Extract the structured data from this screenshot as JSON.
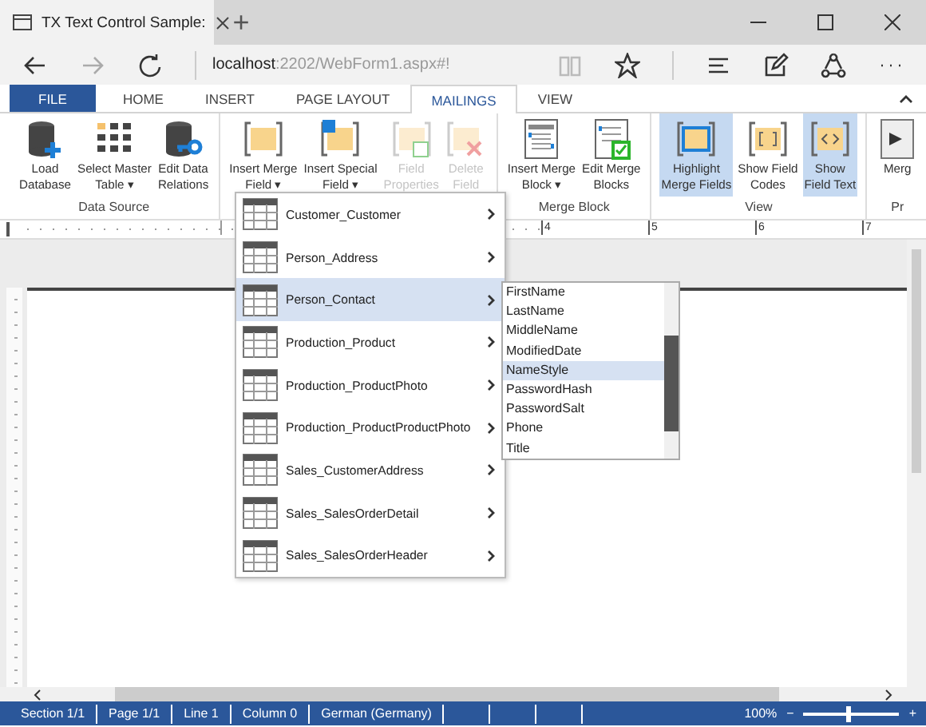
{
  "browser": {
    "tab_title": "TX Text Control Sample:",
    "new_tab": "+",
    "url_host": "localhost",
    "url_path": ":2202/WebForm1.aspx#!"
  },
  "ribbon": {
    "tabs": [
      {
        "label": "FILE",
        "kind": "file",
        "selected": false
      },
      {
        "label": "HOME",
        "kind": "tab",
        "selected": false
      },
      {
        "label": "INSERT",
        "kind": "tab",
        "selected": false
      },
      {
        "label": "PAGE LAYOUT",
        "kind": "tab",
        "selected": false
      },
      {
        "label": "MAILINGS",
        "kind": "tab",
        "selected": true
      },
      {
        "label": "VIEW",
        "kind": "tab",
        "selected": false
      }
    ],
    "groups": [
      {
        "label": "Data Source",
        "buttons": [
          {
            "label": "Load\nDatabase",
            "disabled": false,
            "selected": false
          },
          {
            "label": "Select Master\nTable ▾",
            "disabled": false,
            "selected": false
          },
          {
            "label": "Edit Data\nRelations",
            "disabled": false,
            "selected": false
          }
        ]
      },
      {
        "buttons": [
          {
            "label": "Insert Merge\nField ▾",
            "disabled": false,
            "selected": false
          },
          {
            "label": "Insert Special\nField ▾",
            "disabled": false,
            "selected": false
          },
          {
            "label": "Field\nProperties",
            "disabled": true,
            "selected": false
          },
          {
            "label": "Delete\nField",
            "disabled": true,
            "selected": false
          }
        ]
      },
      {
        "label": "Merge Block",
        "buttons": [
          {
            "label": "Insert Merge\nBlock ▾",
            "disabled": false,
            "selected": false
          },
          {
            "label": "Edit Merge\nBlocks",
            "disabled": false,
            "selected": false
          }
        ]
      },
      {
        "label": "View",
        "buttons": [
          {
            "label": "Highlight\nMerge Fields",
            "disabled": false,
            "selected": true
          },
          {
            "label": "Show Field\nCodes",
            "disabled": false,
            "selected": false
          },
          {
            "label": "Show\nField Text",
            "disabled": false,
            "selected": true
          }
        ]
      },
      {
        "label": "Pr",
        "buttons": [
          {
            "label": "Merg",
            "disabled": false,
            "selected": false
          }
        ]
      }
    ]
  },
  "ruler": {
    "numbers": [
      "4",
      "5",
      "6",
      "7"
    ]
  },
  "table_menu": {
    "items": [
      {
        "label": "Customer_Customer",
        "selected": false
      },
      {
        "label": "Person_Address",
        "selected": false
      },
      {
        "label": "Person_Contact",
        "selected": true
      },
      {
        "label": "Production_Product",
        "selected": false
      },
      {
        "label": "Production_ProductPhoto",
        "selected": false
      },
      {
        "label": "Production_ProductProductPhoto",
        "selected": false
      },
      {
        "label": "Sales_CustomerAddress",
        "selected": false
      },
      {
        "label": "Sales_SalesOrderDetail",
        "selected": false
      },
      {
        "label": "Sales_SalesOrderHeader",
        "selected": false
      }
    ]
  },
  "field_menu": {
    "items": [
      {
        "label": "FirstName",
        "selected": false
      },
      {
        "label": "LastName",
        "selected": false
      },
      {
        "label": "MiddleName",
        "selected": false
      },
      {
        "label": "ModifiedDate",
        "selected": false
      },
      {
        "label": "NameStyle",
        "selected": true
      },
      {
        "label": "PasswordHash",
        "selected": false
      },
      {
        "label": "PasswordSalt",
        "selected": false
      },
      {
        "label": "Phone",
        "selected": false
      },
      {
        "label": "Title",
        "selected": false
      }
    ]
  },
  "status_bar": {
    "cells": [
      "Section 1/1",
      "Page 1/1",
      "Line 1",
      "Column 0",
      "German (Germany)"
    ],
    "zoom": "100%",
    "minus": "−",
    "plus": "+",
    "level": 0.45
  }
}
